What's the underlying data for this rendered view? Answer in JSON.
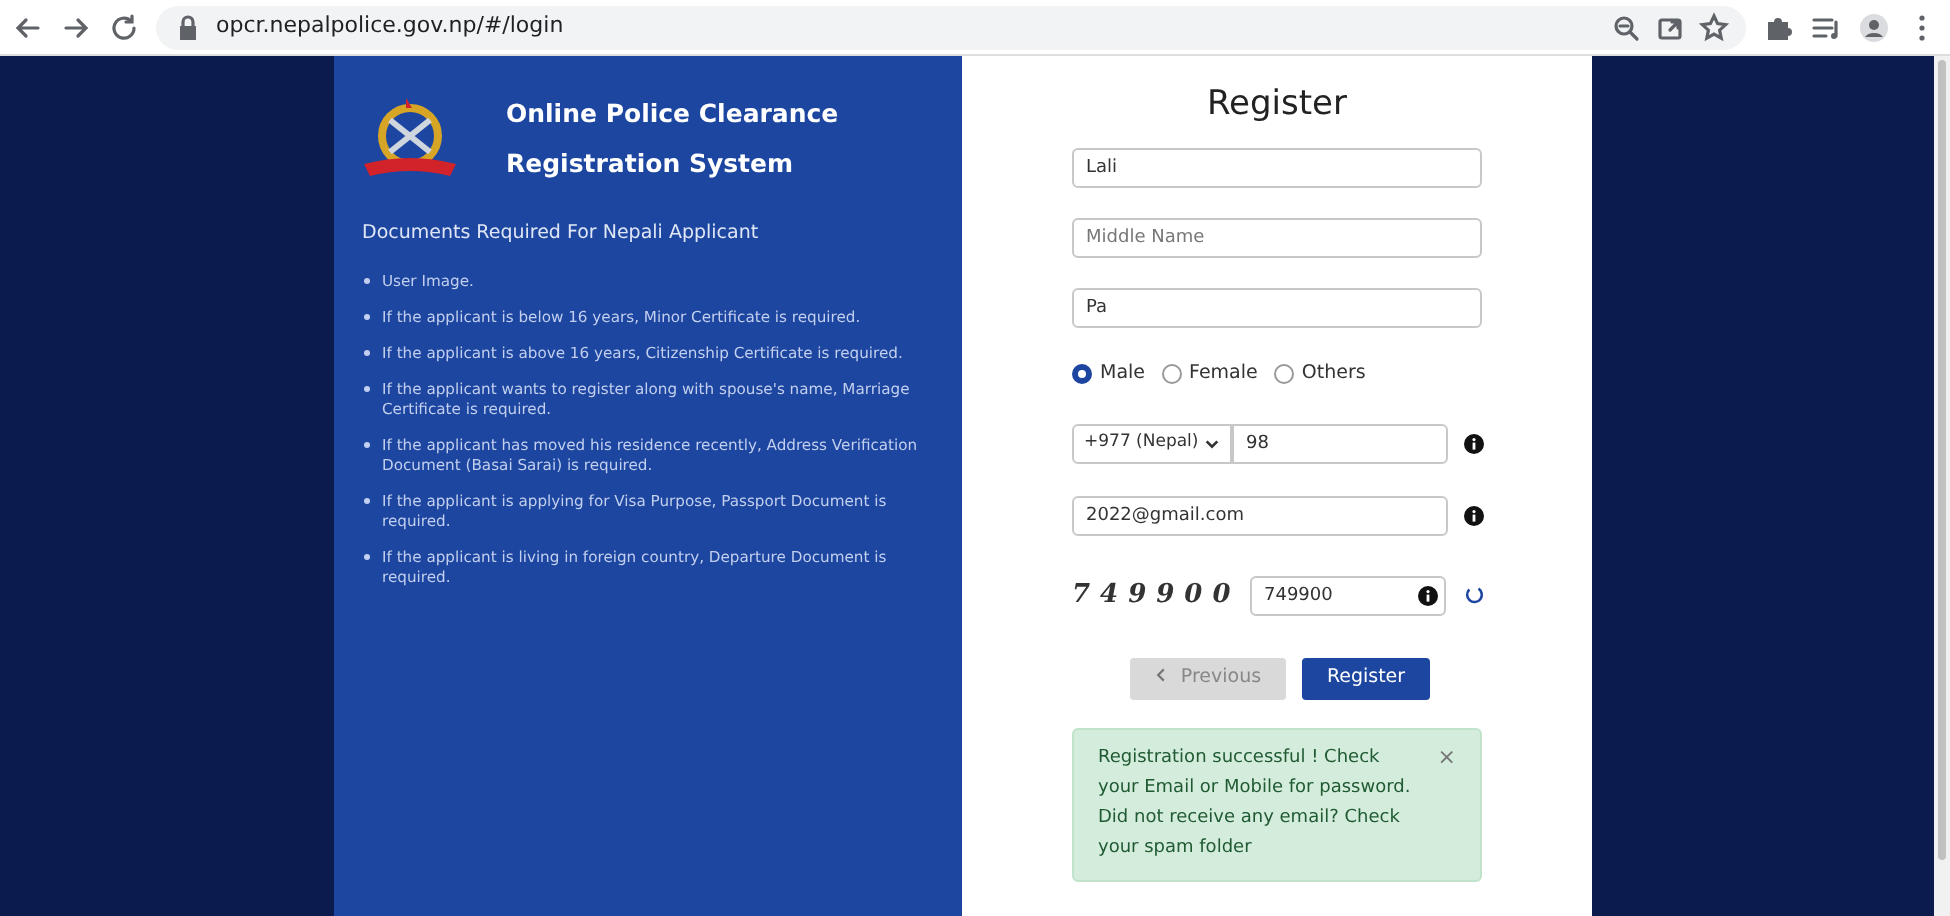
{
  "browser": {
    "url": "opcr.nepalpolice.gov.np/#/login"
  },
  "info_panel": {
    "title_lines": [
      "Online Police Clearance",
      "Registration System"
    ],
    "heading": "Documents Required For Nepali Applicant",
    "documents": [
      "User Image.",
      "If the applicant is below 16 years, Minor Certificate is required.",
      "If the applicant is above 16 years, Citizenship Certificate is required.",
      "If the applicant wants to register along with spouse's name, Marriage Certificate is required.",
      "If the applicant has moved his residence recently, Address Verification Document (Basai Sarai) is required.",
      "If the applicant is applying for Visa Purpose, Passport Document is required.",
      "If the applicant is living in foreign country, Departure Document is required."
    ]
  },
  "form": {
    "title": "Register",
    "name_fields": [
      {
        "value": "Lali"
      },
      {
        "placeholder": "Middle Name"
      },
      {
        "value": "Pa"
      }
    ],
    "gender": [
      {
        "label": "Male",
        "selected": true
      },
      {
        "label": "Female",
        "selected": false
      },
      {
        "label": "Others",
        "selected": false
      }
    ],
    "country_code": "+977 (Nepal)",
    "mobile": "98",
    "email": "2022@gmail.com",
    "captcha_text": "749900",
    "captcha_input": "749900",
    "buttons": [
      {
        "label": "Previous",
        "kind": "secondary",
        "disabled": true
      },
      {
        "label": "Register",
        "kind": "primary",
        "disabled": false
      }
    ],
    "alert": {
      "text": "Registration successful ! Check your Email or Mobile for password. Did not receive any email? Check your spam folder",
      "close": "×"
    }
  }
}
